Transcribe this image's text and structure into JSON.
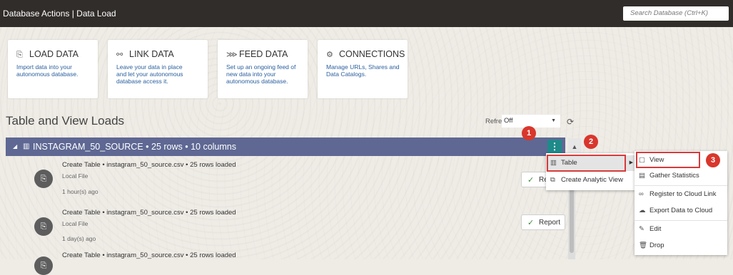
{
  "topbar": {
    "title": "Database Actions | Data Load",
    "search_placeholder": "Search Database (Ctrl+K)"
  },
  "cards": [
    {
      "title": "LOAD DATA",
      "icon": "⎘",
      "desc": [
        "Import data into your",
        "autonomous database."
      ]
    },
    {
      "title": "LINK DATA",
      "icon": "⚯",
      "desc": [
        "Leave your data in place",
        "and let your autonomous",
        "database access it."
      ]
    },
    {
      "title": "FEED DATA",
      "icon": "⋙",
      "desc": [
        "Set up an ongoing feed of",
        "new data into your",
        "autonomous database."
      ]
    },
    {
      "title": "CONNECTIONS",
      "icon": "⚙",
      "desc": [
        "Manage URLs, Shares and",
        "Data Catalogs."
      ]
    }
  ],
  "section_title": "Table and View Loads",
  "refresh": {
    "label": "Refresh",
    "value": "Off"
  },
  "group": {
    "name": "INSTAGRAM_50_SOURCE • 25 rows • 10 columns"
  },
  "rows": [
    {
      "title": "Create Table • instagram_50_source.csv • 25 rows loaded",
      "source": "Local File",
      "age": "1 hour(s) ago",
      "report": "Rep"
    },
    {
      "title": "Create Table • instagram_50_source.csv • 25 rows loaded",
      "source": "Local File",
      "age": "1 day(s) ago",
      "report": "Report"
    },
    {
      "title": "Create Table • instagram_50_source.csv • 25 rows loaded"
    }
  ],
  "menu1": [
    {
      "label": "Table",
      "icon": "▥"
    },
    {
      "label": "Create Analytic View",
      "icon": "⧉"
    }
  ],
  "menu2": [
    {
      "label": "View",
      "icon": "▢"
    },
    {
      "label": "Gather Statistics",
      "icon": "▤"
    },
    {
      "label": "Register to Cloud Link",
      "icon": "∞"
    },
    {
      "label": "Export Data to Cloud",
      "icon": "☁"
    },
    {
      "label": "Edit",
      "icon": "✎"
    },
    {
      "label": "Drop",
      "icon": "🗑"
    }
  ],
  "badges": [
    "1",
    "2",
    "3"
  ],
  "colors": {
    "topbar": "#312d2a",
    "group_header": "#5e6893",
    "kebab": "#1f8a8a",
    "badge": "#d9362c",
    "link_text": "#2a5f9e"
  }
}
